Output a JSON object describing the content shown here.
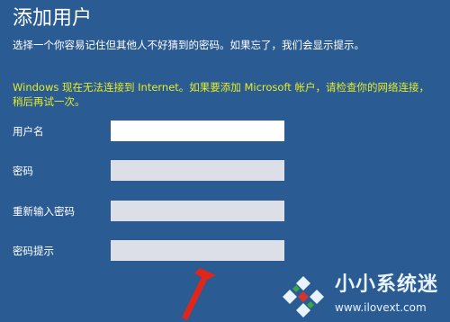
{
  "page": {
    "title": "添加用户",
    "subtitle": "选择一个你容易记住但其他人不好猜到的密码。如果忘了，我们会显示提示。",
    "warning": "Windows 现在无法连接到 Internet。如果要添加 Microsoft 帐户，请检查你的网络连接，稍后再试一次。"
  },
  "form": {
    "fields": [
      {
        "label": "用户名",
        "value": "",
        "state": "active"
      },
      {
        "label": "密码",
        "value": "",
        "state": "inactive"
      },
      {
        "label": "重新输入密码",
        "value": "",
        "state": "inactive"
      },
      {
        "label": "密码提示",
        "value": "",
        "state": "inactive"
      }
    ]
  },
  "annotation": {
    "arrow_color": "#e0251b"
  },
  "watermark": {
    "title": "小小系统迷",
    "url": "www.ilovext.com"
  },
  "colors": {
    "background": "#2b5b93",
    "warning_text": "#e3ec2a",
    "input_active": "#ffffff",
    "input_inactive": "#dcdfe8"
  }
}
